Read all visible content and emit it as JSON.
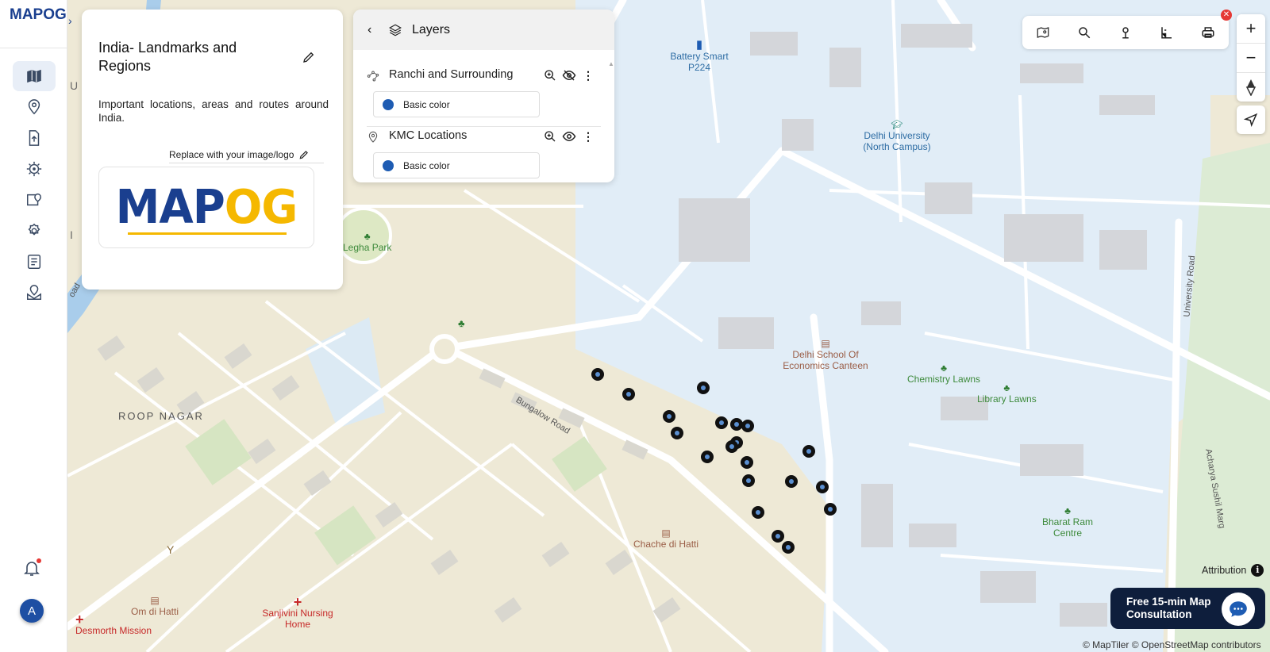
{
  "app": {
    "logo_text": "MAPOG"
  },
  "info_panel": {
    "title": "India- Landmarks and Regions",
    "description": "Important locations, areas and routes around India.",
    "replace_logo_label": "Replace with your image/logo",
    "logo_main": "MAP",
    "logo_accent": "OG"
  },
  "layers_panel": {
    "title": "Layers",
    "layers": [
      {
        "name": "Ranchi and Surrounding",
        "style_label": "Basic color",
        "visible": false,
        "color": "#1e5cb3"
      },
      {
        "name": "KMC Locations",
        "style_label": "Basic color",
        "visible": true,
        "color": "#1e5cb3"
      }
    ]
  },
  "map": {
    "labels": {
      "battery": "Battery Smart P224",
      "delhi_uni": "Delhi University (North Campus)",
      "legha_park": "Legha Park",
      "roop_nagar": "ROOP NAGAR",
      "bungalow_road": "Bungalow Road",
      "dse_canteen": "Delhi School Of Economics Canteen",
      "chemistry_lawns": "Chemistry Lawns",
      "library_lawns": "Library Lawns",
      "university_road": "University Road",
      "acharya_marg": "Acharya Sushil Marg",
      "bharat_ram": "Bharat Ram Centre",
      "chache": "Chache di Hatti",
      "om_di_hatti": "Om di Hatti",
      "sanjivini": "Sanjivini Nursing Home",
      "mission": "Desmorth Mission",
      "road_frag": "oad",
      "u_frag": "U",
      "i_frag": "I"
    },
    "markers_count": 21
  },
  "controls": {
    "attribution": "Attribution",
    "consult": "Free 15-min Map Consultation",
    "copyright": "© MapTiler © OpenStreetMap contributors",
    "avatar_initial": "A",
    "zoom_in": "+",
    "zoom_out": "−"
  }
}
